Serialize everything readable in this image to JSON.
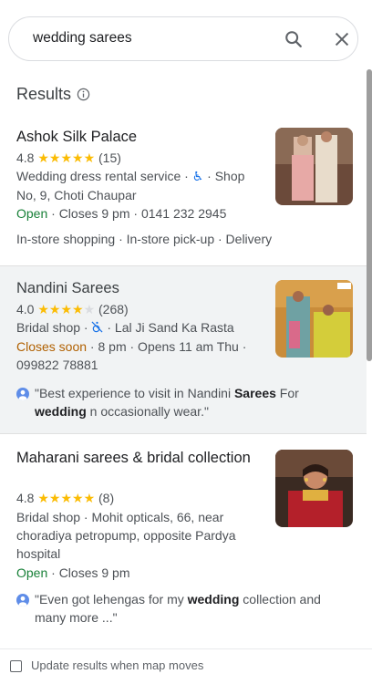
{
  "search": {
    "query": "wedding sarees",
    "search_icon": "search-icon",
    "close_icon": "close-icon"
  },
  "results_header": {
    "title": "Results",
    "info_icon": "info-icon"
  },
  "results": [
    {
      "name": "Ashok Silk Palace",
      "rating": "4.8",
      "stars": "★★★★★",
      "rating_value": 4.8,
      "reviews": "(15)",
      "category_line1": "Wedding dress rental service · ",
      "accessible_icon": "wheelchair-icon",
      "category_line1_rest": " · Shop",
      "address_line2": "No, 9, Choti Chaupar",
      "status": "Open",
      "hours": " · Closes 9 pm · 0141 232 2945",
      "services": "In-store shopping · In-store pick-up · Delivery"
    },
    {
      "name": "Nandini Sarees",
      "rating": "4.0",
      "stars_filled": "★★★★",
      "stars_empty": "★",
      "rating_value": 4.0,
      "reviews": "(268)",
      "category": "Bridal shop · ",
      "accessible_icon": "wheelchair-off-icon",
      "address": " · Lal Ji Sand Ka Rasta",
      "status": "Closes soon",
      "hours": " · 8 pm · Opens 11 am Thu ·",
      "phone": "099822 78881",
      "review_part1": "\"Best experience to visit in Nandini ",
      "review_bold1": "Sarees",
      "review_part2": " For",
      "review_bold2": "wedding",
      "review_part3": " n occasionally wear.\""
    },
    {
      "name": "Maharani sarees & bridal collection",
      "rating": "4.8",
      "stars": "★★★★★",
      "rating_value": 4.8,
      "reviews": "(8)",
      "address_line1": "Bridal shop · Mohit opticals, 66, near",
      "address_line2": "choradiya petropump, opposite Pardya",
      "address_line3": "hospital",
      "status": "Open",
      "hours": " · Closes 9 pm",
      "review_part1": "\"Even got lehengas for my ",
      "review_bold1": "wedding",
      "review_part2": " collection and",
      "review_line2": "many more ...\""
    }
  ],
  "footer": {
    "checkbox_label": "Update results when map moves"
  },
  "colors": {
    "open": "#188038",
    "closing": "#b06000",
    "star": "#fbbc04",
    "accent": "#1a73e8"
  }
}
